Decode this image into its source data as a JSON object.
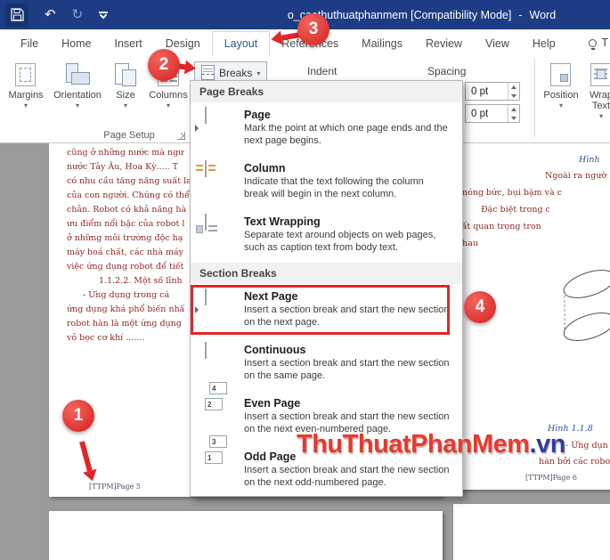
{
  "titlebar": {
    "title": "o_caothuthuatphanmem [Compatibility Mode]",
    "separator": "-",
    "app": "Word"
  },
  "tabs": {
    "items": [
      "File",
      "Home",
      "Insert",
      "Design",
      "Layout",
      "References",
      "Mailings",
      "Review",
      "View",
      "Help"
    ],
    "active": "Layout",
    "tellme": "T"
  },
  "ribbon": {
    "caret": "▾",
    "buttons": [
      "Margins",
      "Orientation",
      "Size",
      "Columns"
    ],
    "breaks_button": "Breaks",
    "indent_label": "Indent",
    "spacing_label": "Spacing",
    "spacing_fields": [
      "0 pt",
      "0 pt"
    ],
    "position_button": "Position",
    "wrap_text_button": "Wrap Text",
    "group_label": "Page Setup"
  },
  "menu": {
    "icon_numbers": {
      "even": [
        "2",
        "4"
      ],
      "odd": [
        "1",
        "3"
      ]
    },
    "sections": [
      {
        "header": "Page Breaks",
        "items": [
          {
            "title": "Page",
            "desc": "Mark the point at which one page ends and the next page begins."
          },
          {
            "title": "Column",
            "desc": "Indicate that the text following the column break will begin in the next column."
          },
          {
            "title": "Text Wrapping",
            "desc": "Separate text around objects on web pages, such as caption text from body text."
          }
        ]
      },
      {
        "header": "Section Breaks",
        "items": [
          {
            "title": "Next Page",
            "desc": "Insert a section break and start the new section on the next page."
          },
          {
            "title": "Continuous",
            "desc": "Insert a section break and start the new section on the same page."
          },
          {
            "title": "Even Page",
            "desc": "Insert a section break and start the new section on the next even-numbered page."
          },
          {
            "title": "Odd Page",
            "desc": "Insert a section break and start the new section on the next odd-numbered page."
          }
        ]
      }
    ]
  },
  "document": {
    "left_page": {
      "lines": [
        "cũng ở những nước mà ngư",
        "nước Tây Âu, Hoa Kỳ..... T",
        "có nhu cầu tăng năng suất la",
        "của con người. Chúng có thể",
        "chân. Robot có khả năng hà",
        "ưu điểm nổi bậc của robot l",
        "ở những môi trường độc hạ",
        "máy hoá chất, các nhà máy",
        "việc ứng dụng robot để tiết",
        "1.1.2.2. Một số lĩnh",
        "- Ứng dụng trong cá",
        "ứng dụng khá phổ biến nhấ",
        "robot hàn là một ứng dụng",
        "vỏ bọc cơ khí ......."
      ],
      "footer": "[TTPM]Page 5"
    },
    "right_page": {
      "lines": [
        "Hình",
        "Ngoài ra ngườ",
        "nóng bức, bụi bặm và c",
        "Đặc biệt trong c",
        "rất quan trọng tron",
        "nhau",
        "Hình 1.1.8",
        "- Ứng dụn",
        "hàn bởi các robot"
      ],
      "footer": "[TTPM]Page 6"
    },
    "watermark": {
      "text": "ThuThuatPhanMem",
      "suffix": ".vn"
    }
  },
  "annotations": {
    "step1": "1",
    "step2": "2",
    "step3": "3",
    "step4": "4"
  }
}
